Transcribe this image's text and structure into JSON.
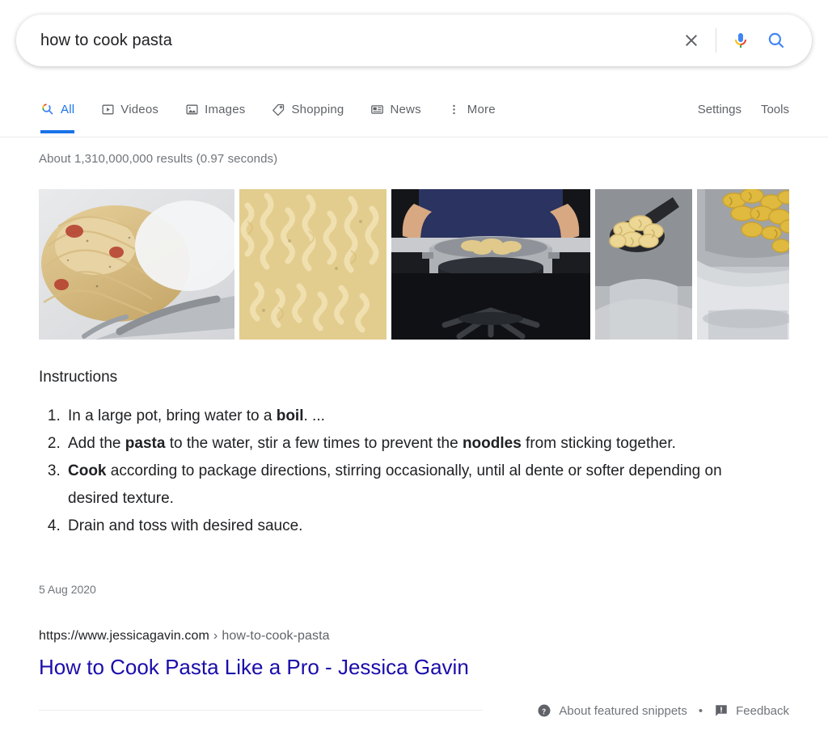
{
  "search": {
    "query": "how to cook pasta",
    "placeholder": "Search",
    "clear_label": "Clear",
    "voice_label": "Search by voice",
    "submit_label": "Google Search"
  },
  "nav": {
    "tabs": [
      {
        "label": "All",
        "icon": "google-search-icon",
        "active": true
      },
      {
        "label": "Videos",
        "icon": "video-icon",
        "active": false
      },
      {
        "label": "Images",
        "icon": "image-icon",
        "active": false
      },
      {
        "label": "Shopping",
        "icon": "tag-icon",
        "active": false
      },
      {
        "label": "News",
        "icon": "news-icon",
        "active": false
      },
      {
        "label": "More",
        "icon": "more-vert-icon",
        "active": false
      }
    ],
    "tools": [
      {
        "label": "Settings"
      },
      {
        "label": "Tools"
      }
    ]
  },
  "results": {
    "stats": "About 1,310,000,000 results (0.97 seconds)"
  },
  "images": [
    {
      "alt": "Spaghetti carbonara on a white plate with a fork"
    },
    {
      "alt": "Close-up of cooked fusilli pasta"
    },
    {
      "alt": "Person lifting a colander of pasta over a pot on a stove"
    },
    {
      "alt": "Slotted spoon holding fusilli above a pot"
    },
    {
      "alt": "Fusilli being poured from a pot"
    }
  ],
  "snippet": {
    "title": "Instructions",
    "steps": [
      {
        "parts": [
          {
            "text": "In a large pot, bring water to a ",
            "bold": false
          },
          {
            "text": "boil",
            "bold": true
          },
          {
            "text": ". ...",
            "bold": false
          }
        ]
      },
      {
        "parts": [
          {
            "text": "Add the ",
            "bold": false
          },
          {
            "text": "pasta",
            "bold": true
          },
          {
            "text": " to the water, stir a few times to prevent the ",
            "bold": false
          },
          {
            "text": "noodles",
            "bold": true
          },
          {
            "text": " from sticking together.",
            "bold": false
          }
        ]
      },
      {
        "parts": [
          {
            "text": "Cook",
            "bold": true
          },
          {
            "text": " according to package directions, stirring occasionally, until al dente or softer depending on desired texture.",
            "bold": false
          }
        ]
      },
      {
        "parts": [
          {
            "text": "Drain and toss with desired sauce.",
            "bold": false
          }
        ]
      }
    ],
    "date": "5 Aug 2020",
    "url_domain": "https://www.jessicagavin.com",
    "url_separator": "›",
    "url_path": "how-to-cook-pasta",
    "heading": "How to Cook Pasta Like a Pro - Jessica Gavin"
  },
  "footer": {
    "about_label": "About featured snippets",
    "separator": "•",
    "feedback_label": "Feedback",
    "about_icon": "help-circle-icon",
    "feedback_icon": "feedback-icon"
  },
  "colors": {
    "link": "#1a0dab",
    "accent": "#1a73e8",
    "text": "#202124",
    "muted": "#70757a",
    "google_blue": "#4285f4",
    "google_red": "#ea4335",
    "google_yellow": "#fbbc05",
    "google_green": "#34a853"
  }
}
